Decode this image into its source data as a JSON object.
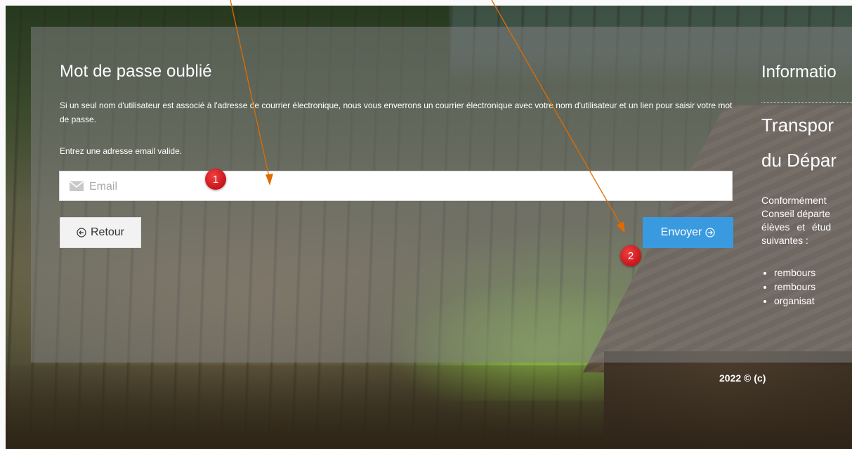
{
  "forgot_password": {
    "title": "Mot de passe oublié",
    "description": "Si un seul nom d'utilisateur est associé à l'adresse de courrier électronique, nous vous enverrons un courrier électronique avec votre nom d'utilisateur et un lien pour saisir votre mot de passe.",
    "hint": "Entrez une adresse email valide.",
    "email_placeholder": "Email",
    "email_value": "",
    "back_label": "Retour",
    "send_label": "Envoyer"
  },
  "info": {
    "title": "Informatio",
    "subtitle_line1": "Transpor",
    "subtitle_line2": "du Dépar",
    "paragraph_lines": [
      "Conformément",
      "Conseil départe",
      "élèves et étud",
      "suivantes :"
    ],
    "list_items": [
      "rembours",
      "rembours",
      "organisat"
    ]
  },
  "footer": {
    "text": "2022 © (c)"
  },
  "annotations": {
    "badge1": "1",
    "badge2": "2",
    "color": "#e06c00"
  },
  "colors": {
    "send_button": "#3a9ae0",
    "badge": "#d4161e"
  }
}
